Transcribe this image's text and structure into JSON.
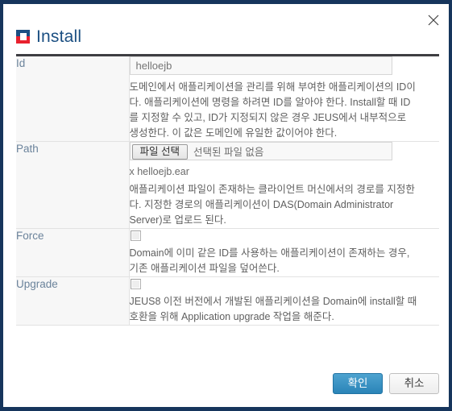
{
  "window": {
    "title": "Install",
    "icon": "install-logo-icon",
    "close_icon": "close-icon",
    "frame_color": "#16355c",
    "title_color": "#1b4f82"
  },
  "rows": [
    {
      "label": "Id",
      "control": "text",
      "value": "helloejb",
      "placeholder": "helloejb",
      "desc": "도메인에서 애플리케이션을 관리를 위해 부여한 애플리케이션의 ID이다. 애플리케이션에 명령을 하려면 ID를 알아야 한다. Install할 때 ID를 지정할 수 있고, ID가 지정되지 않은 경우 JEUS에서 내부적으로 생성한다. 이 값은 도메인에 유일한 값이어야 한다."
    },
    {
      "label": "Path",
      "control": "file",
      "file_button": "파일 선택",
      "file_status": "선택된 파일 없음",
      "filename": "x helloejb.ear",
      "desc": "애플리케이션 파일이 존재하는 클라이언트 머신에서의 경로를 지정한다. 지정한 경로의 애플리케이션이 DAS(Domain Administrator Server)로 업로드 된다."
    },
    {
      "label": "Force",
      "control": "checkbox",
      "checked": false,
      "desc": "Domain에 이미 같은 ID를 사용하는 애플리케이션이 존재하는 경우, 기존 애플리케이션 파일을 덮어쓴다."
    },
    {
      "label": "Upgrade",
      "control": "checkbox",
      "checked": false,
      "desc": "JEUS8 이전 버전에서 개발된 애플리케이션을 Domain에 install할 때 호환을 위해 Application upgrade 작업을 해준다."
    }
  ],
  "footer": {
    "confirm_label": "확인",
    "cancel_label": "취소",
    "confirm_color": "#2a84b8"
  }
}
